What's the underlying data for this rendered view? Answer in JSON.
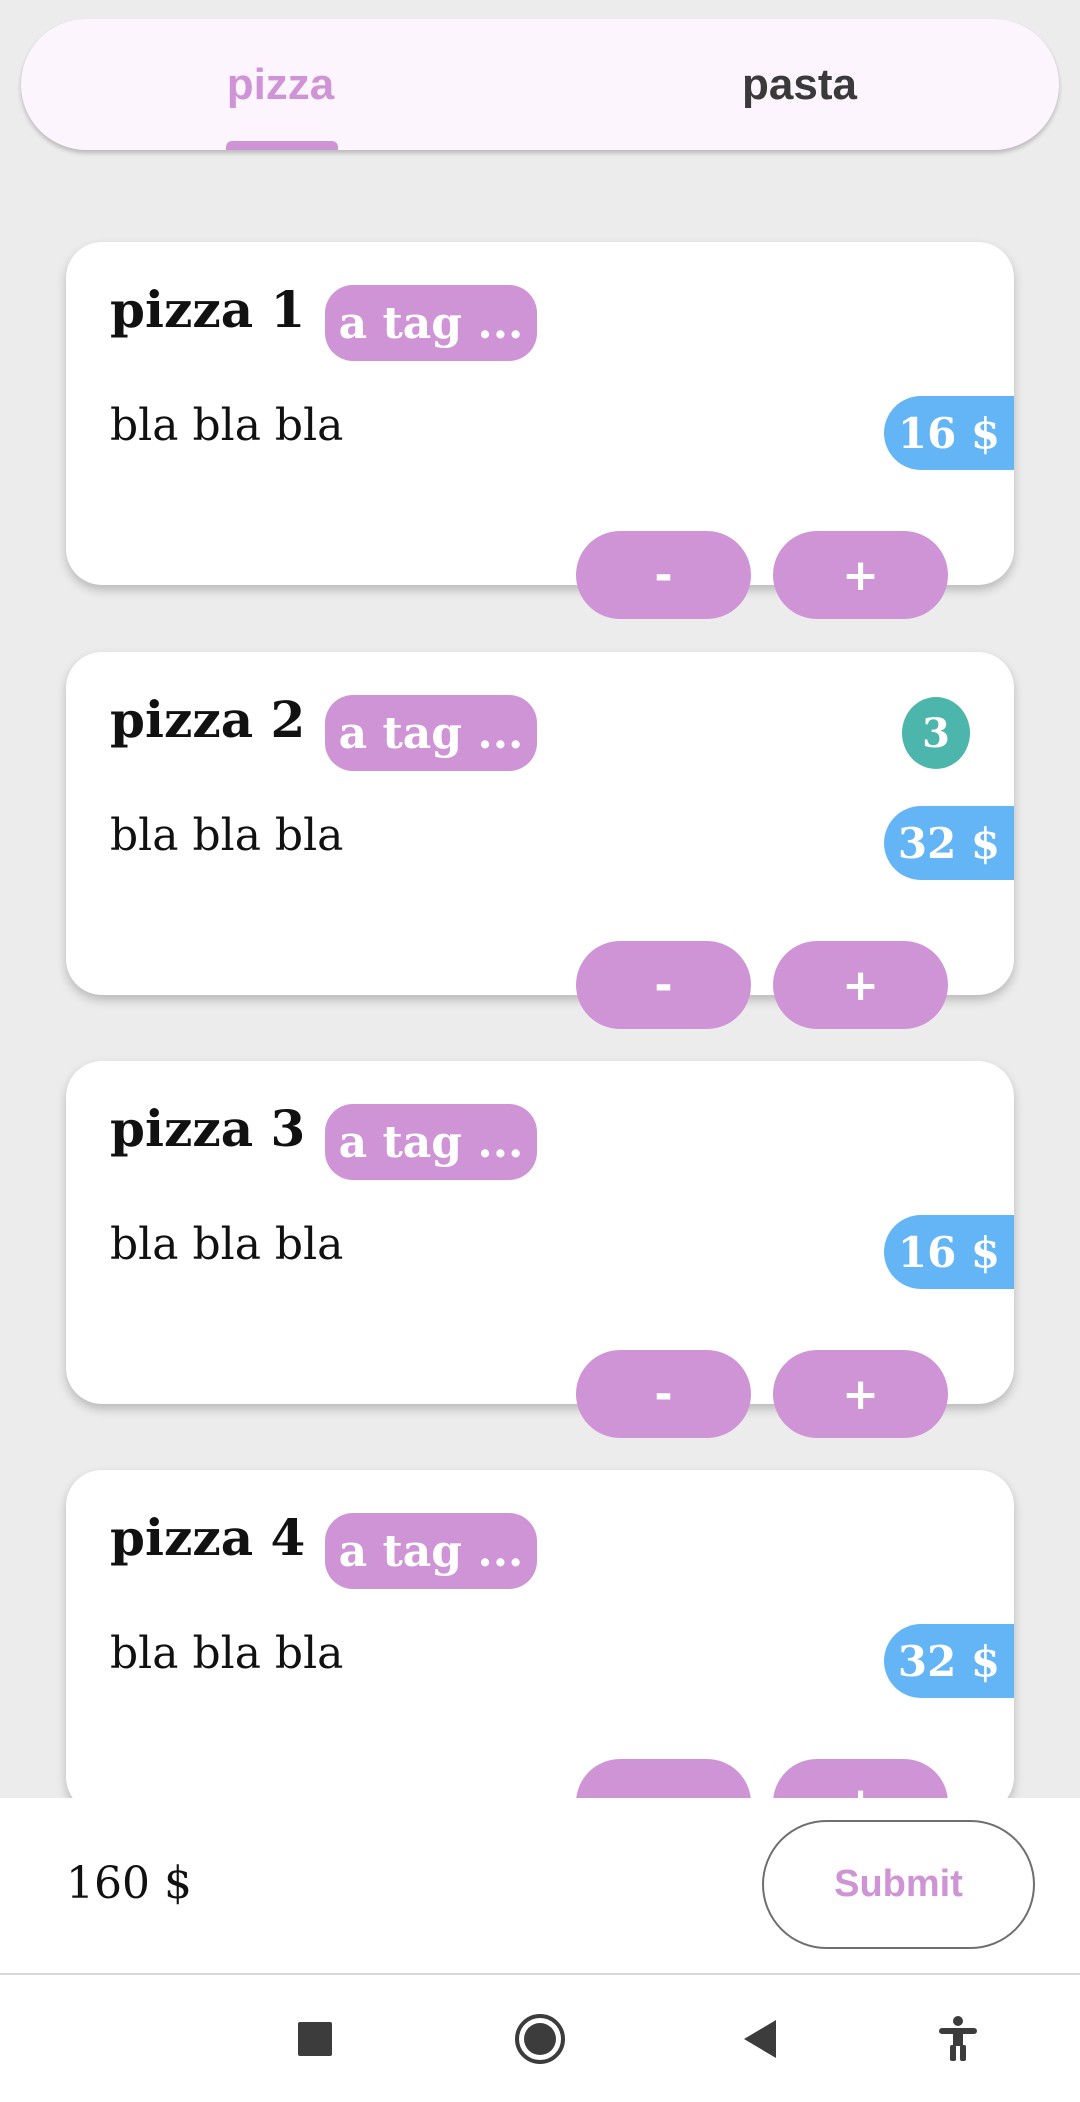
{
  "tabs": [
    {
      "label": "pizza",
      "selected": true
    },
    {
      "label": "pasta",
      "selected": false
    }
  ],
  "items": [
    {
      "title": "pizza 1",
      "tag": "a tag ...",
      "description": "bla bla bla",
      "price": "16 $",
      "count": "",
      "minus": "-",
      "plus": "+"
    },
    {
      "title": "pizza 2",
      "tag": "a tag ...",
      "description": "bla bla bla",
      "price": "32 $",
      "count": "3",
      "minus": "-",
      "plus": "+"
    },
    {
      "title": "pizza 3",
      "tag": "a tag ...",
      "description": "bla bla bla",
      "price": "16 $",
      "count": "",
      "minus": "-",
      "plus": "+"
    },
    {
      "title": "pizza 4",
      "tag": "a tag ...",
      "description": "bla bla bla",
      "price": "32 $",
      "count": "",
      "minus": "-",
      "plus": "+"
    }
  ],
  "footer": {
    "total": "160 $",
    "submit_label": "Submit"
  },
  "system_nav": [
    "recents-icon",
    "home-icon",
    "back-icon",
    "accessibility-icon"
  ],
  "colors": {
    "accent": "#cf94d6",
    "price": "#64b5f6",
    "count_badge": "#4db6ac",
    "background": "#ececec"
  }
}
